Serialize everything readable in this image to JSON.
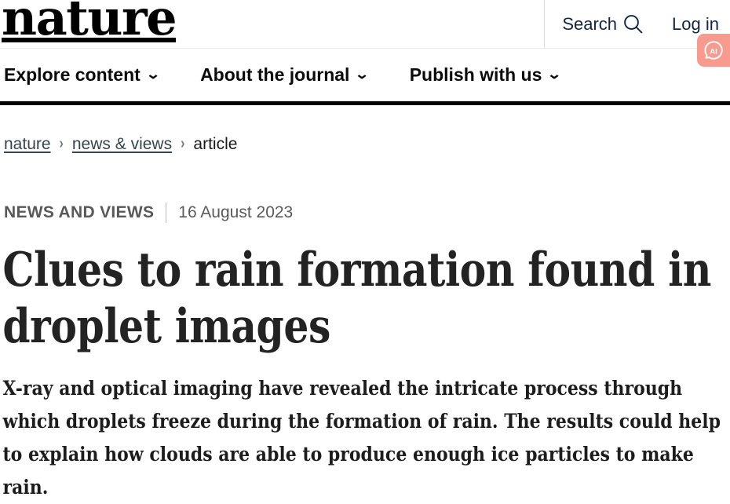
{
  "header": {
    "logo_text": "nature",
    "search_label": "Search",
    "search_icon": "search-icon",
    "login_label": "Log in",
    "ai_badge_label": "AI",
    "ai_badge_color": "#f99a8e"
  },
  "nav": {
    "items": [
      {
        "label": "Explore content",
        "chevron": "⌄"
      },
      {
        "label": "About the journal",
        "chevron": "⌄"
      },
      {
        "label": "Publish with us",
        "chevron": "⌄"
      }
    ]
  },
  "breadcrumb": {
    "separator": "›",
    "items": [
      {
        "label": "nature",
        "link": true
      },
      {
        "label": "news & views",
        "link": true
      },
      {
        "label": "article",
        "link": false
      }
    ]
  },
  "article": {
    "kicker": "NEWS AND VIEWS",
    "date": "16 August 2023",
    "headline": "Clues to rain formation found in droplet images",
    "standfirst": "X-ray and optical imaging have revealed the intricate process through which droplets freeze during the formation of rain. The results could help to explain how clouds are able to produce enough ice particles to make rain."
  }
}
